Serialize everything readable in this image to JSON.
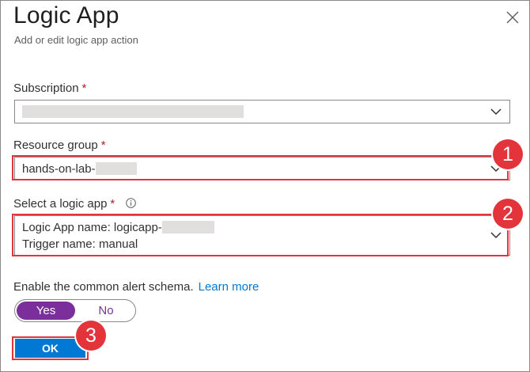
{
  "dialog": {
    "title": "Logic App",
    "subtitle": "Add or edit logic app action",
    "close_icon": "close-icon"
  },
  "subscription": {
    "label": "Subscription",
    "required_mark": "*",
    "value": "",
    "icon": "chevron-down-icon"
  },
  "resource_group": {
    "label": "Resource group",
    "required_mark": "*",
    "value": "hands-on-lab-",
    "icon": "chevron-down-icon"
  },
  "logic_app": {
    "label": "Select a logic app",
    "required_mark": "*",
    "info_icon": "info-icon",
    "line1": "Logic App name: logicapp-",
    "line2": "Trigger name: manual",
    "icon": "chevron-down-icon"
  },
  "schema": {
    "label": "Enable the common alert schema.",
    "learn_more": "Learn more",
    "options": [
      "Yes",
      "No"
    ],
    "selected": "Yes"
  },
  "ok_button": {
    "label": "OK"
  },
  "annotations": {
    "step1": "1",
    "step2": "2",
    "step3": "3"
  },
  "colors": {
    "highlight": "#e3343c",
    "accent": "#0078d4",
    "toggle": "#7b2f9a",
    "required": "#a4262c"
  }
}
